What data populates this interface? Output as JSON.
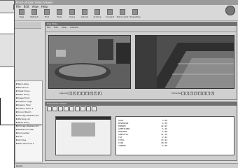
{
  "left_panel": {
    "close_glyph": "✕",
    "row_buttons": [
      "✚",
      "✕",
      "⟳"
    ],
    "swap_glyph": "⇅"
  },
  "window": {
    "title": "Point-of-Sale Video Viewer",
    "menus": [
      "File",
      "Edit",
      "View",
      "Help"
    ],
    "toolbar": [
      "New",
      "Refresh",
      "Find",
      "Tools",
      "Users",
      "Alarms",
      "Archive",
      "Connect",
      "Disconnect",
      "Properties"
    ],
    "tree": [
      "Bar Lobby",
      "Bar Room",
      "Valet Drive",
      "Main Entry",
      "Cage Front",
      "Cashier Cage",
      "Casino Floor",
      "Casino Floor 2",
      "Count Room",
      "Chicago Restaurant",
      "Parking Lot",
      "Back Entry",
      "Chicago Restaurant",
      "Restaurant Bar",
      "Connected",
      "Live",
      "Archive",
      "POS Terminal 1"
    ],
    "video": {
      "title": "Live Video",
      "menu": [
        "File",
        "Edit",
        "View",
        "Camera"
      ],
      "pager_label_left": "Layouts",
      "pager_label_right": "Cameras",
      "pages": [
        "1",
        "2",
        "3",
        "4",
        "5",
        "6",
        "7",
        "8"
      ]
    },
    "report": {
      "title": "Transaction Viewer",
      "lines": [
        {
          "label": "SALE",
          "value": "3.00"
        },
        {
          "label": "BEVERAGE",
          "value": "4.50"
        },
        {
          "label": "ENTREE",
          "value": "12.95"
        },
        {
          "label": "APPETIZER",
          "value": "6.25"
        },
        {
          "label": "DESSERT",
          "value": "5.00"
        },
        {
          "label": "SUBTOTAL",
          "value": "31.70"
        },
        {
          "label": "TAX",
          "value": "2.22"
        },
        {
          "label": "TOTAL",
          "value": "33.92"
        },
        {
          "label": "CASH",
          "value": "40.00"
        },
        {
          "label": "CHANGE",
          "value": "6.08"
        }
      ]
    },
    "status": "Ready"
  }
}
